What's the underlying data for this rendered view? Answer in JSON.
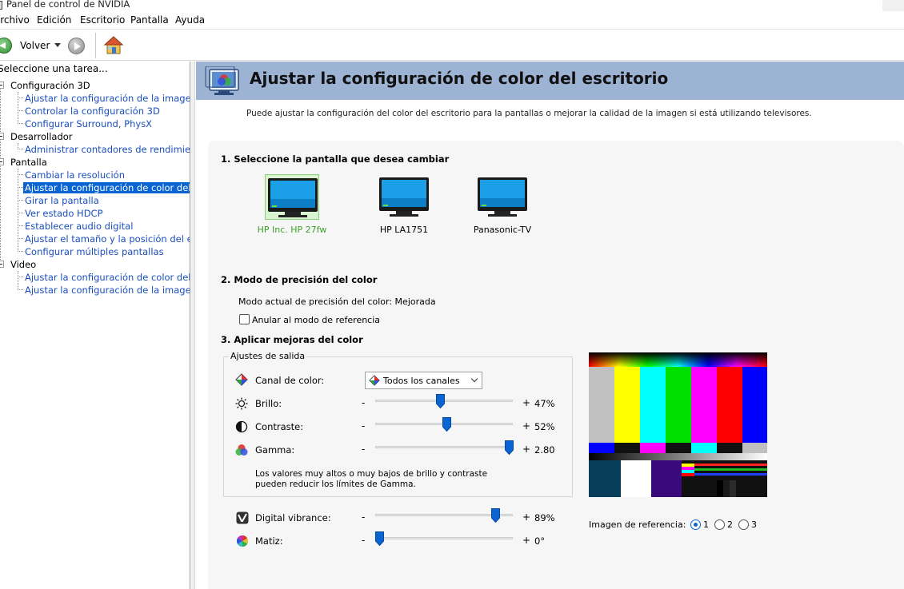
{
  "window": {
    "title": "Panel de control de NVIDIA"
  },
  "menubar": {
    "items": [
      "Archivo",
      "Edición",
      "Escritorio",
      "Pantalla",
      "Ayuda"
    ]
  },
  "toolbar": {
    "back_label": "Volver"
  },
  "sidebar": {
    "header": "Seleccione una tarea...",
    "groups": [
      {
        "label": "Configuración 3D",
        "items": [
          "Ajustar la configuración de la imagen con vista previa",
          "Controlar la configuración 3D",
          "Configurar Surround, PhysX"
        ]
      },
      {
        "label": "Desarrollador",
        "items": [
          "Administrar contadores de rendimiento de GPU"
        ]
      },
      {
        "label": "Pantalla",
        "items": [
          "Cambiar la resolución",
          "Ajustar la configuración de color del escritorio",
          "Girar la pantalla",
          "Ver estado HDCP",
          "Establecer audio digital",
          "Ajustar el tamaño y la posición del escritorio",
          "Configurar múltiples pantallas"
        ]
      },
      {
        "label": "Video",
        "items": [
          "Ajustar la configuración de color del video",
          "Ajustar la configuración de la imagen de video"
        ]
      }
    ],
    "selected_item": "Ajustar la configuración de color del escritorio"
  },
  "main": {
    "title": "Ajustar la configuración de color del escritorio",
    "intro": "Puede ajustar la configuración del color del escritorio para la pantallas o mejorar la calidad de la imagen si está utilizando televisores.",
    "section1_title": "1. Seleccione la pantalla que desea cambiar",
    "displays": [
      {
        "name": "HP Inc. HP 27fw",
        "selected": true
      },
      {
        "name": "HP LA1751",
        "selected": false
      },
      {
        "name": "Panasonic-TV",
        "selected": false
      }
    ],
    "section2_title": "2. Modo de precisión del color",
    "precision_mode_text": "Modo actual de precisión del color: Mejorada",
    "override_checkbox_label": "Anular al modo de referencia",
    "override_checked": false,
    "section3_title": "3. Aplicar mejoras del color",
    "output_group_label": "Ajustes de salida",
    "channel_label": "Canal de color:",
    "channel_value": "Todos los canales",
    "sliders": {
      "brightness": {
        "label": "Brillo:",
        "value_text": "47%",
        "fraction": 0.47
      },
      "contrast": {
        "label": "Contraste:",
        "value_text": "52%",
        "fraction": 0.52
      },
      "gamma": {
        "label": "Gamma:",
        "value_text": "2.80",
        "fraction": 0.97
      },
      "vibrance": {
        "label": "Digital vibrance:",
        "value_text": "89%",
        "fraction": 0.87
      },
      "hue": {
        "label": "Matiz:",
        "value_text": "0°",
        "fraction": 0.03
      }
    },
    "minus_sign": "-",
    "plus_sign": "+",
    "gamma_note": "Los valores muy altos o muy bajos de brillo y contraste pueden reducir los límites de Gamma.",
    "reference_image_label": "Imagen de referencia:",
    "reference_options": [
      "1",
      "2",
      "3"
    ],
    "reference_selected": "1"
  },
  "colors": {
    "banner": "#9db3d3",
    "selection": "#0a64d2",
    "link": "#1a4fbf",
    "selected_display": "#3fa12a"
  }
}
